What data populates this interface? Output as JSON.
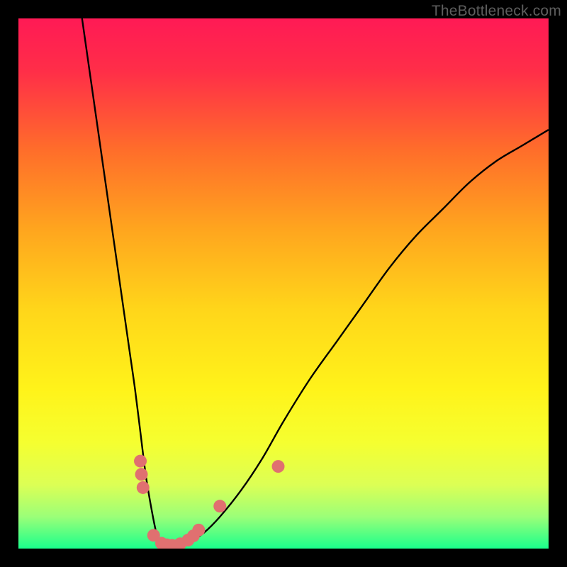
{
  "watermark": "TheBottleneck.com",
  "chart_data": {
    "type": "line",
    "title": "",
    "xlabel": "",
    "ylabel": "",
    "xlim": [
      0,
      100
    ],
    "ylim": [
      0,
      100
    ],
    "grid": false,
    "gradient_stops": [
      {
        "offset": 0.0,
        "color": "#ff1a55"
      },
      {
        "offset": 0.1,
        "color": "#ff2e48"
      },
      {
        "offset": 0.25,
        "color": "#ff6e2a"
      },
      {
        "offset": 0.4,
        "color": "#ffa61e"
      },
      {
        "offset": 0.55,
        "color": "#ffd61a"
      },
      {
        "offset": 0.7,
        "color": "#fff31a"
      },
      {
        "offset": 0.8,
        "color": "#f5ff30"
      },
      {
        "offset": 0.88,
        "color": "#dcff55"
      },
      {
        "offset": 0.94,
        "color": "#9bff78"
      },
      {
        "offset": 1.0,
        "color": "#1aff8c"
      }
    ],
    "series": [
      {
        "name": "curve",
        "color": "#000000",
        "x": [
          12,
          13,
          14,
          15,
          16,
          17,
          18,
          19,
          20,
          21,
          22,
          23,
          24,
          25,
          26,
          27,
          28,
          29,
          30,
          32,
          35,
          38,
          42,
          46,
          50,
          55,
          60,
          65,
          70,
          75,
          80,
          85,
          90,
          95,
          100
        ],
        "y": [
          100,
          93,
          86,
          79,
          72,
          65,
          58,
          51,
          44,
          37,
          30,
          22,
          14,
          8,
          3,
          0,
          0,
          0,
          0,
          1,
          3,
          6,
          11,
          17,
          24,
          32,
          39,
          46,
          53,
          59,
          64,
          69,
          73,
          76,
          79
        ]
      }
    ],
    "markers": [
      {
        "x": 23.0,
        "y": 16.5
      },
      {
        "x": 23.2,
        "y": 14.0
      },
      {
        "x": 23.5,
        "y": 11.5
      },
      {
        "x": 25.5,
        "y": 2.5
      },
      {
        "x": 27.0,
        "y": 1.0
      },
      {
        "x": 28.0,
        "y": 0.7
      },
      {
        "x": 29.0,
        "y": 0.6
      },
      {
        "x": 30.5,
        "y": 0.9
      },
      {
        "x": 32.0,
        "y": 1.6
      },
      {
        "x": 33.0,
        "y": 2.4
      },
      {
        "x": 34.0,
        "y": 3.5
      },
      {
        "x": 38.0,
        "y": 8.0
      },
      {
        "x": 49.0,
        "y": 15.5
      }
    ],
    "marker_style": {
      "shape": "circle",
      "radius_pct": 1.2,
      "fill": "#e07070",
      "stroke": "none"
    }
  }
}
